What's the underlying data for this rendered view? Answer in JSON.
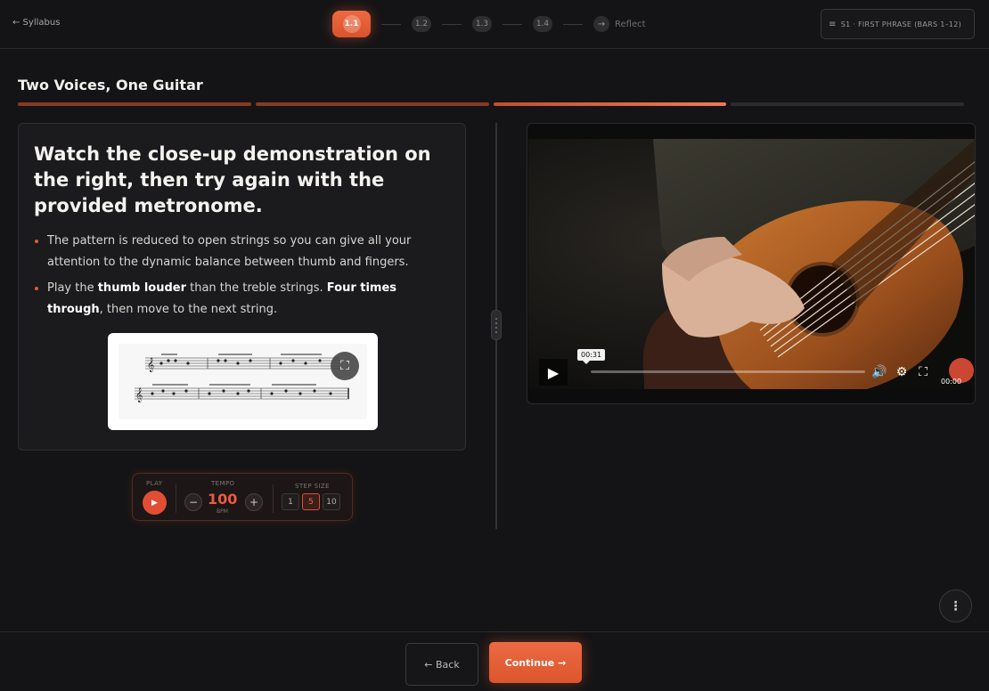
{
  "header": {
    "back_label": "← Syllabus",
    "steps": [
      {
        "label": "1.1",
        "state": "current"
      },
      {
        "label": "1.2",
        "state": "upcoming"
      },
      {
        "label": "1.3",
        "state": "upcoming"
      },
      {
        "label": "1.4",
        "state": "upcoming"
      }
    ],
    "reflect_icon": "→",
    "reflect_label": "Reflect",
    "section_label": "S1 · FIRST PHRASE (BARS 1–12)"
  },
  "lesson": {
    "title": "Two Voices, One Guitar",
    "progress": {
      "segments": 4,
      "completed": 2,
      "current_index": 2
    }
  },
  "card": {
    "heading": "Watch the close-up demonstration on the right, then try again with the provided metronome.",
    "bullet1": "The pattern is reduced to open strings so you can give all your attention to the dynamic balance between thumb and fingers.",
    "bullet2_a": "Play the ",
    "bullet2_b": "thumb louder",
    "bullet2_c": " than the treble strings. ",
    "bullet2_d": "Four times through",
    "bullet2_e": ", then move to the next string."
  },
  "metronome": {
    "play_label": "PLAY",
    "tempo_label": "TEMPO",
    "tempo_value": "100",
    "tempo_unit": "BPM",
    "minus": "−",
    "plus": "+",
    "step_label": "STEP SIZE",
    "step_options": [
      "1",
      "5",
      "10"
    ],
    "selected_step": "5"
  },
  "video": {
    "tooltip_time": "00:31",
    "current_time": "00:00",
    "progress": 0.0
  },
  "footer": {
    "back_label": "← Back",
    "continue_label": "Continue →"
  },
  "colors": {
    "accent": "#e85a32",
    "background": "#141416",
    "card": "#1b1b1e"
  }
}
